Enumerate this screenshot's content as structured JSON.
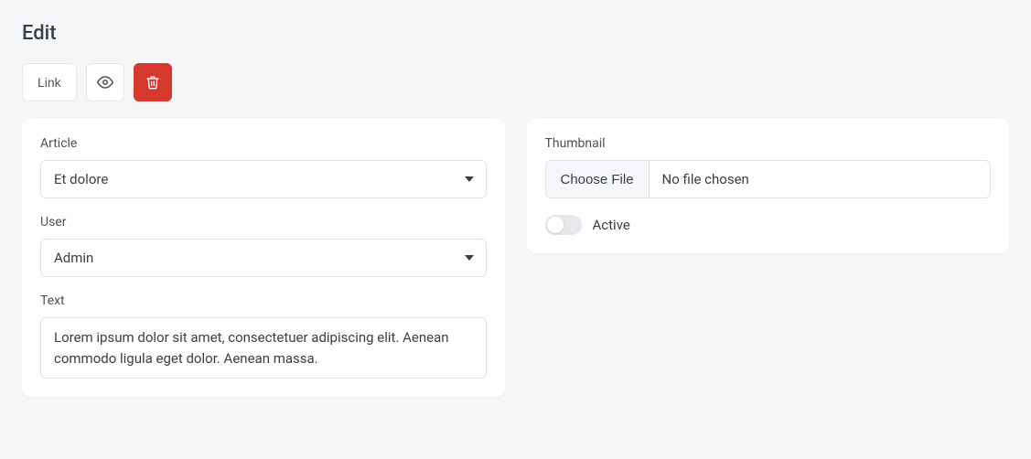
{
  "page": {
    "title": "Edit"
  },
  "toolbar": {
    "link_label": "Link",
    "view_icon": "eye-icon",
    "delete_icon": "trash-icon"
  },
  "form_left": {
    "article": {
      "label": "Article",
      "value": "Et dolore"
    },
    "user": {
      "label": "User",
      "value": "Admin"
    },
    "text": {
      "label": "Text",
      "value": "Lorem ipsum dolor sit amet, consectetuer adipiscing elit. Aenean commodo ligula eget dolor. Aenean massa."
    }
  },
  "form_right": {
    "thumbnail": {
      "label": "Thumbnail",
      "button_label": "Choose File",
      "status": "No file chosen"
    },
    "active": {
      "label": "Active",
      "value": false
    }
  }
}
